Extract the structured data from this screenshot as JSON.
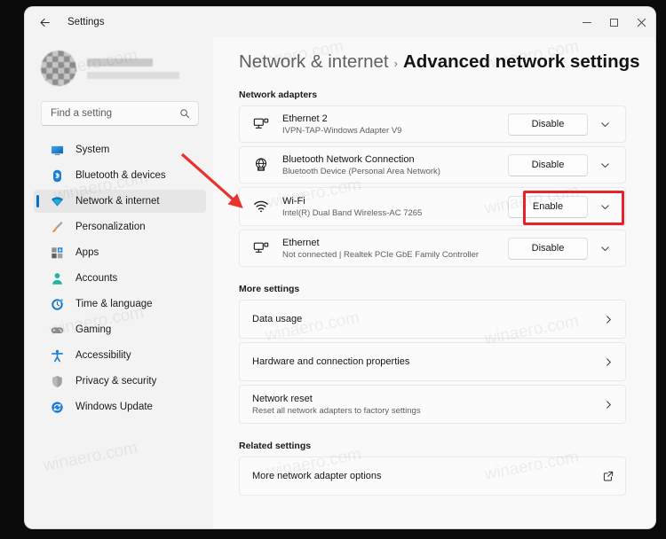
{
  "window": {
    "app_title": "Settings",
    "back_icon": "back-arrow-icon",
    "minimize_label": "Minimize",
    "maximize_label": "Maximize",
    "close_label": "Close"
  },
  "sidebar": {
    "account": {
      "name_redacted": "",
      "email_redacted": ""
    },
    "search": {
      "placeholder": "Find a setting",
      "value": "",
      "icon": "search-icon"
    },
    "items": [
      {
        "label": "System",
        "icon": "system-icon",
        "selected": false
      },
      {
        "label": "Bluetooth & devices",
        "icon": "bluetooth-icon",
        "selected": false
      },
      {
        "label": "Network & internet",
        "icon": "network-icon",
        "selected": true
      },
      {
        "label": "Personalization",
        "icon": "personalization-icon",
        "selected": false
      },
      {
        "label": "Apps",
        "icon": "apps-icon",
        "selected": false
      },
      {
        "label": "Accounts",
        "icon": "accounts-icon",
        "selected": false
      },
      {
        "label": "Time & language",
        "icon": "time-icon",
        "selected": false
      },
      {
        "label": "Gaming",
        "icon": "gaming-icon",
        "selected": false
      },
      {
        "label": "Accessibility",
        "icon": "accessibility-icon",
        "selected": false
      },
      {
        "label": "Privacy & security",
        "icon": "privacy-icon",
        "selected": false
      },
      {
        "label": "Windows Update",
        "icon": "windows-update-icon",
        "selected": false
      }
    ]
  },
  "content": {
    "breadcrumb": {
      "parent": "Network & internet",
      "separator": "›",
      "current": "Advanced network settings"
    },
    "sections": {
      "network_adapters": {
        "heading": "Network adapters",
        "adapters": [
          {
            "name": "Ethernet 2",
            "detail": "IVPN-TAP-Windows Adapter V9",
            "action": "Disable",
            "icon": "ethernet-icon",
            "highlighted": false
          },
          {
            "name": "Bluetooth Network Connection",
            "detail": "Bluetooth Device (Personal Area Network)",
            "action": "Disable",
            "icon": "bluetooth-network-icon",
            "highlighted": false
          },
          {
            "name": "Wi-Fi",
            "detail": "Intel(R) Dual Band Wireless-AC 7265",
            "action": "Enable",
            "icon": "wifi-icon",
            "highlighted": true
          },
          {
            "name": "Ethernet",
            "detail": "Not connected | Realtek PCIe GbE Family Controller",
            "action": "Disable",
            "icon": "ethernet-icon",
            "highlighted": false
          }
        ]
      },
      "more_settings": {
        "heading": "More settings",
        "items": [
          {
            "title": "Data usage",
            "detail": "",
            "chevron": "chevron-right-icon"
          },
          {
            "title": "Hardware and connection properties",
            "detail": "",
            "chevron": "chevron-right-icon"
          },
          {
            "title": "Network reset",
            "detail": "Reset all network adapters to factory settings",
            "chevron": "chevron-right-icon"
          }
        ]
      },
      "related_settings": {
        "heading": "Related settings",
        "items": [
          {
            "title": "More network adapter options",
            "icon": "external-link-icon"
          }
        ]
      }
    }
  },
  "annotations": {
    "highlight_color": "#e8222a",
    "arrow_color": "#e8322f",
    "highlight_target": "Enable",
    "arrow_target": "Wi-Fi"
  },
  "watermark": {
    "text": "winaero.com"
  }
}
